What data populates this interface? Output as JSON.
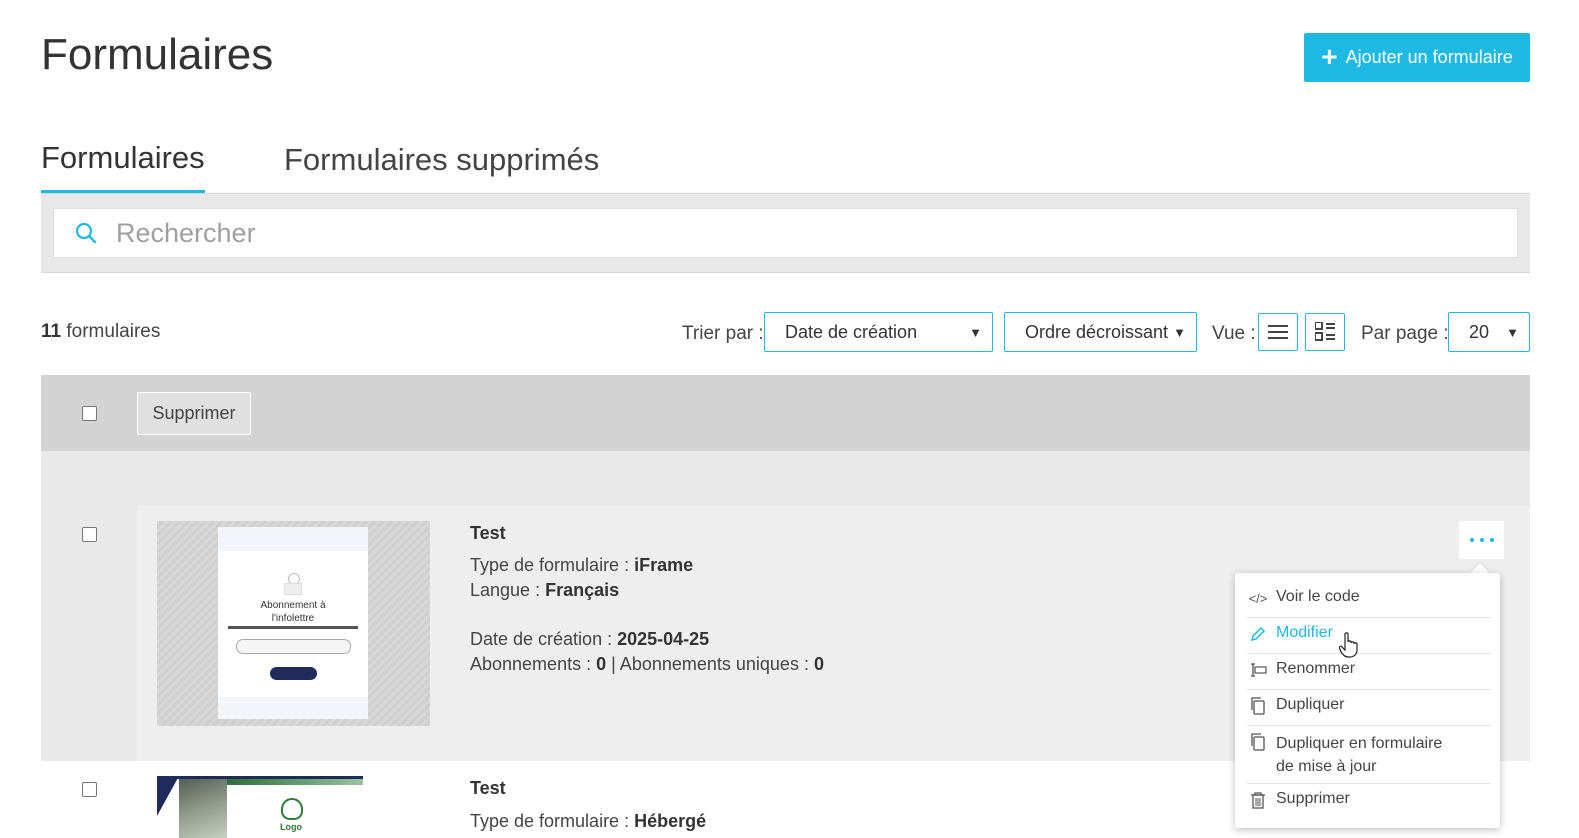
{
  "header": {
    "title": "Formulaires",
    "add_button_label": "Ajouter un formulaire"
  },
  "tabs": [
    {
      "label": "Formulaires",
      "active": true
    },
    {
      "label": "Formulaires supprimés",
      "active": false
    }
  ],
  "search": {
    "placeholder": "Rechercher"
  },
  "toolbar": {
    "count_number": "11",
    "count_label": "formulaires",
    "sort_label": "Trier par :",
    "sort_field": "Date de création",
    "sort_order": "Ordre décroissant",
    "view_label": "Vue :",
    "per_page_label": "Par page :",
    "per_page_value": "20"
  },
  "bulk": {
    "delete_label": "Supprimer"
  },
  "forms": [
    {
      "title": "Test",
      "type_label": "Type de formulaire :",
      "type_value": "iFrame",
      "lang_label": "Langue :",
      "lang_value": "Français",
      "date_label": "Date de création :",
      "date_value": "2025-04-25",
      "subs_label": "Abonnements :",
      "subs_value": "0",
      "unique_label": "| Abonnements uniques :",
      "unique_value": "0",
      "thumbnail": {
        "title_line1": "Abonnement à",
        "title_line2": "l'infolettre"
      }
    },
    {
      "title": "Test",
      "type_label": "Type de formulaire :",
      "type_value": "Hébergé",
      "thumbnail": {
        "logo_text": "Logo"
      }
    }
  ],
  "menu": {
    "items": [
      {
        "label": "Voir le code",
        "icon": "code-icon"
      },
      {
        "label": "Modifier",
        "icon": "pencil-icon",
        "active": true
      },
      {
        "label": "Renommer",
        "icon": "rename-icon"
      },
      {
        "label": "Dupliquer",
        "icon": "copy-icon"
      },
      {
        "label": "Dupliquer en formulaire de mise à jour",
        "line1": "Dupliquer en formulaire",
        "line2": "de mise à jour",
        "icon": "copy-icon"
      },
      {
        "label": "Supprimer",
        "icon": "trash-icon"
      }
    ]
  },
  "colors": {
    "accent": "#1eb9e3",
    "header_bar": "#d3d3d3",
    "navy": "#1f2b5b"
  }
}
